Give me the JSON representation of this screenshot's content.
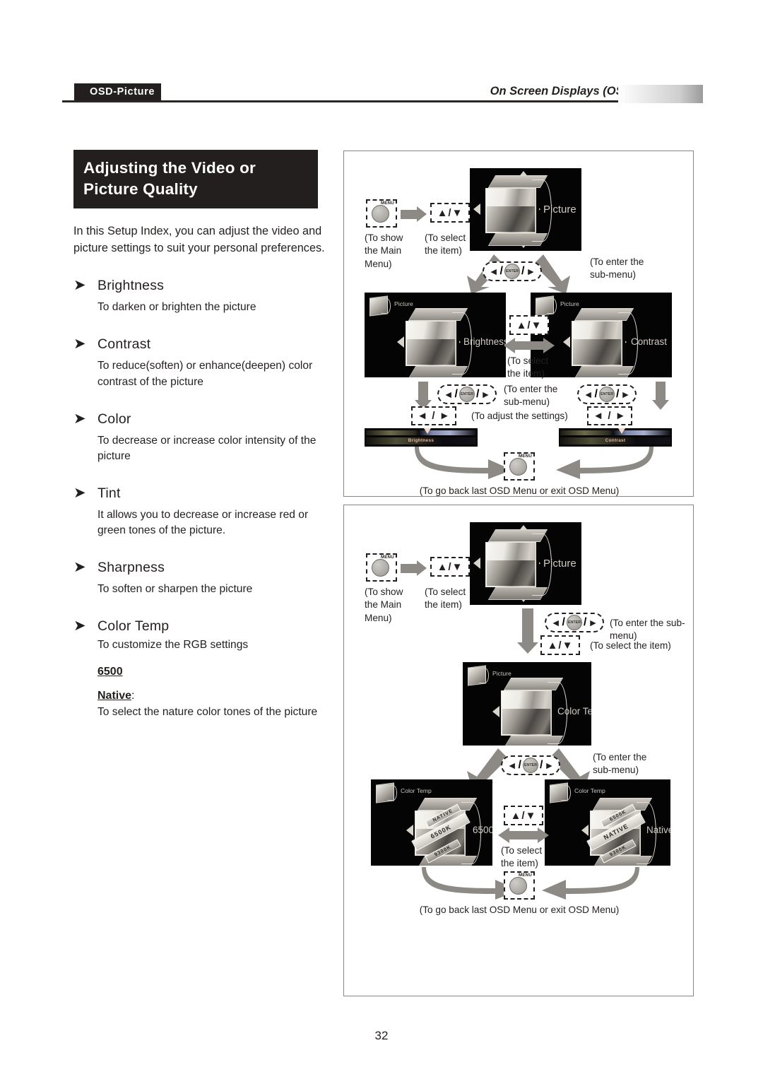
{
  "header": {
    "tab_label": "OSD-Picture",
    "section_title": "On Screen Displays (OSD)",
    "arrow_icon": "right-triangle-icon"
  },
  "page_number": "32",
  "left_column": {
    "title": "Adjusting the Video or Picture Quality",
    "intro": "In this Setup Index, you can adjust the video and picture settings to suit your personal preferences.",
    "features": [
      {
        "name": "Brightness",
        "desc": "To darken or brighten the picture"
      },
      {
        "name": "Contrast",
        "desc": "To reduce(soften) or enhance(deepen) color contrast of the picture"
      },
      {
        "name": "Color",
        "desc": "To decrease or increase color intensity of the picture"
      },
      {
        "name": "Tint",
        "desc": "It allows you to decrease or increase red or green tones of the picture."
      },
      {
        "name": "Sharpness",
        "desc": "To soften or sharpen the picture"
      },
      {
        "name": "Color Temp",
        "desc": "To customize the RGB settings"
      }
    ],
    "color_temp_options": {
      "option_1": "6500",
      "option_2_label": "Native",
      "option_2_colon": ":",
      "option_2_desc": "To select the nature color tones of the picture"
    }
  },
  "diagram_1": {
    "menu_key": {
      "label": "MENU",
      "caption": "(To show\nthe Main\nMenu)"
    },
    "updown_key_1": {
      "glyph": "▲/▼",
      "caption": "(To select\nthe item)"
    },
    "osd_main": {
      "corner_label": "Picture",
      "item_label": "Picture"
    },
    "enter_key_1": {
      "glyph_left": "◄",
      "glyph_right": "►",
      "label": "ENTER",
      "caption": "(To enter the\nsub-menu)"
    },
    "osd_brightness": {
      "corner_label": "Picture",
      "item_label": "Brightness"
    },
    "osd_contrast": {
      "corner_label": "Picture",
      "item_label": "Contrast"
    },
    "updown_key_2": {
      "glyph": "▲/▼",
      "caption": "(To select\nthe item)"
    },
    "enter_key_left": {
      "caption": "(To enter the\nsub-menu)"
    },
    "leftright_caption": "(To adjust the settings)",
    "leftright_key_left": {
      "glyph": "◄ / ►"
    },
    "leftright_key_right": {
      "glyph": "◄ / ►"
    },
    "slider_brightness_label": "Brightness",
    "slider_contrast_label": "Contrast",
    "exit_menu_key": {
      "label": "MENU"
    },
    "exit_caption": "(To go back last OSD Menu or exit OSD Menu)"
  },
  "diagram_2": {
    "menu_key": {
      "label": "MENU",
      "caption": "(To show\nthe Main\nMenu)"
    },
    "updown_key_1": {
      "glyph": "▲/▼",
      "caption": "(To select\nthe item)"
    },
    "osd_main": {
      "corner_label": "Picture",
      "item_label": "Picture"
    },
    "enter_key_1": {
      "label": "ENTER",
      "caption": "(To enter the sub-menu)"
    },
    "updown_key_2": {
      "glyph": "▲/▼",
      "caption": "(To select the item)"
    },
    "osd_colortemp": {
      "corner_label": "Picture",
      "item_label": "Color Temp"
    },
    "enter_key_2": {
      "label": "ENTER",
      "caption": "(To enter the\nsub-menu)"
    },
    "osd_6500k": {
      "corner_label": "Color Temp",
      "item_label": "6500",
      "cube_front": "6500K",
      "cube_top": "NATIVE",
      "cube_bottom": "9300K"
    },
    "osd_native": {
      "corner_label": "Color Temp",
      "item_label": "Native",
      "cube_front": "NATIVE",
      "cube_top": "6500K",
      "cube_bottom": "9300K"
    },
    "updown_key_3": {
      "glyph": "▲/▼",
      "caption": "(To select\nthe item)"
    },
    "exit_menu_key": {
      "label": "MENU"
    },
    "exit_caption": "(To go back last OSD Menu or exit OSD Menu)"
  },
  "colors": {
    "ink": "#231f1e",
    "gray_arrow": "#8d8a85",
    "osd_black": "#050404",
    "box_border": "#8b8580"
  }
}
